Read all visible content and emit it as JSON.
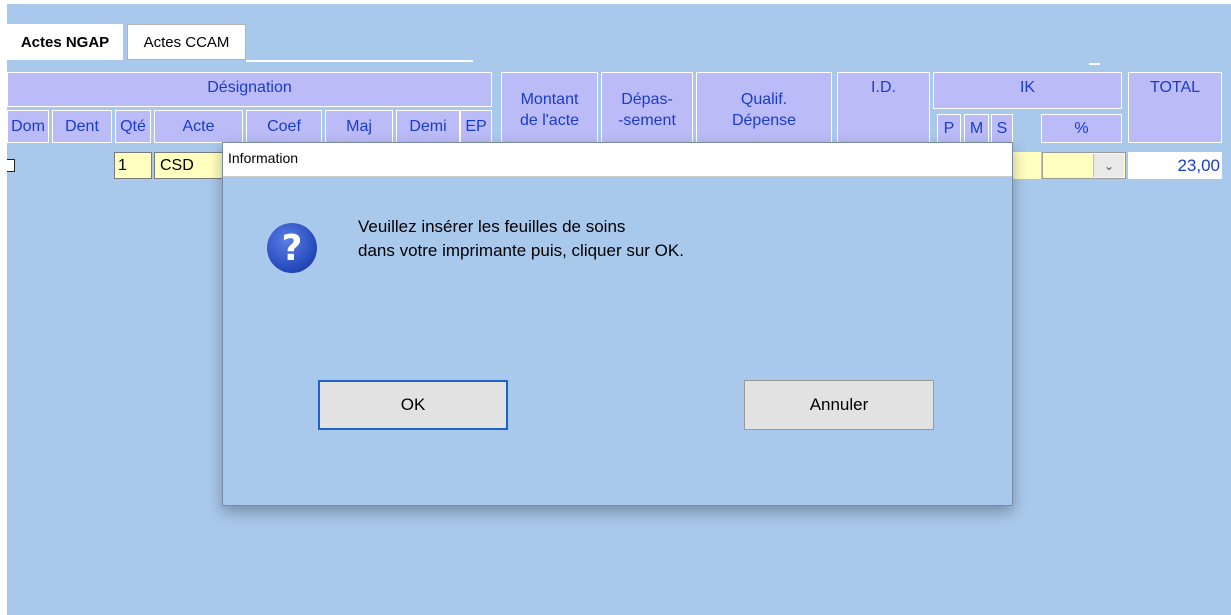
{
  "tabs": [
    "Actes NGAP",
    "Actes CCAM"
  ],
  "table": {
    "headers": {
      "designation": "Désignation",
      "montant_line1": "Montant",
      "montant_line2": "de l'acte",
      "depassement_line1": "Dépas-",
      "depassement_line2": "-sement",
      "qualif_line1": "Qualif.",
      "qualif_line2": "Dépense",
      "id": "I.D.",
      "ik": "IK",
      "total": "TOTAL",
      "dom": "Dom",
      "dent": "Dent",
      "qte": "Qté",
      "acte": "Acte",
      "coef": "Coef",
      "maj": "Maj",
      "demi": "Demi",
      "ep": "EP",
      "p": "P",
      "m": "M",
      "s": "S",
      "pct": "%"
    },
    "row": {
      "qte": "1",
      "acte": "CSD",
      "total": "23,00"
    }
  },
  "dialog": {
    "title": "Information",
    "icon": "question-icon",
    "message_line1": "Veuillez insérer les feuilles de soins",
    "message_line2": "dans votre imprimante puis, cliquer sur OK.",
    "ok_label": "OK",
    "cancel_label": "Annuler"
  },
  "colors": {
    "background": "#a9c9ec",
    "header_fill": "#bbbbf8",
    "header_text": "#1a3ccc",
    "input_fill": "#ffffc0",
    "accent": "#1f63c8"
  }
}
